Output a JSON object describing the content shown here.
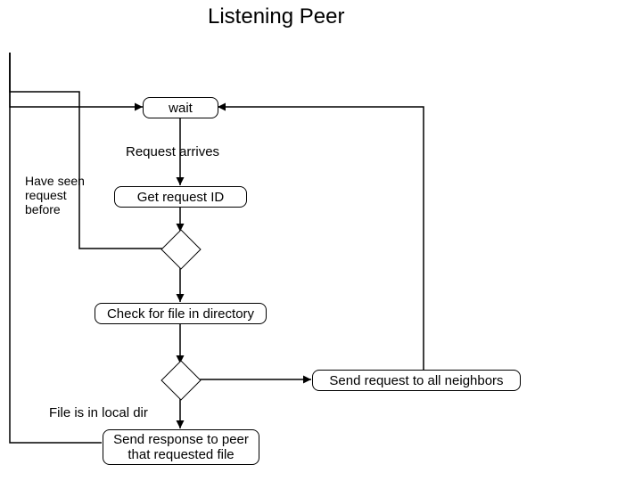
{
  "title": "Listening Peer",
  "nodes": {
    "wait": "wait",
    "get_id": "Get request ID",
    "check_dir": "Check for file in directory",
    "send_neighbors": "Send request to all neighbors",
    "send_response": "Send response to peer\nthat requested file"
  },
  "labels": {
    "request_arrives": "Request arrives",
    "have_seen": "Have seen\nrequest\nbefore",
    "in_local": "File is in local dir"
  }
}
